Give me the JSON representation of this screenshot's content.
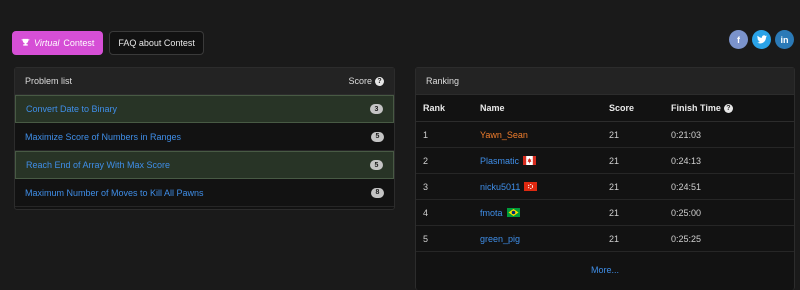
{
  "topbar": {
    "virtual_label_italic": "Virtual",
    "virtual_label_rest": "Contest",
    "faq_label": "FAQ about Contest",
    "social": [
      {
        "icon": "facebook-icon",
        "glyph": "f",
        "color": "#7b93cc"
      },
      {
        "icon": "twitter-icon",
        "glyph": "t",
        "color": "#2aa3e8"
      },
      {
        "icon": "linkedin-icon",
        "glyph": "in",
        "color": "#2b7ab7"
      }
    ]
  },
  "problems": {
    "title": "Problem list",
    "score_header": "Score",
    "items": [
      {
        "title": "Convert Date to Binary",
        "score": "3",
        "solved": true
      },
      {
        "title": "Maximize Score of Numbers in Ranges",
        "score": "5",
        "solved": false
      },
      {
        "title": "Reach End of Array With Max Score",
        "score": "5",
        "solved": true
      },
      {
        "title": "Maximum Number of Moves to Kill All Pawns",
        "score": "8",
        "solved": false
      }
    ]
  },
  "ranking": {
    "title": "Ranking",
    "columns": {
      "rank": "Rank",
      "name": "Name",
      "score": "Score",
      "time": "Finish Time"
    },
    "rows": [
      {
        "rank": "1",
        "name": "Yawn_Sean",
        "name_color": "#f07d2c",
        "flag": "",
        "score": "21",
        "time": "0:21:03"
      },
      {
        "rank": "2",
        "name": "Plasmatic",
        "name_color": "#3f8ee8",
        "flag": "canada-flag-icon",
        "score": "21",
        "time": "0:24:13"
      },
      {
        "rank": "3",
        "name": "nicku5011",
        "name_color": "#3f8ee8",
        "flag": "hong-kong-flag-icon",
        "score": "21",
        "time": "0:24:51"
      },
      {
        "rank": "4",
        "name": "fmota",
        "name_color": "#3f8ee8",
        "flag": "brazil-flag-icon",
        "score": "21",
        "time": "0:25:00"
      },
      {
        "rank": "5",
        "name": "green_pig",
        "name_color": "#3f8ee8",
        "flag": "",
        "score": "21",
        "time": "0:25:25"
      }
    ],
    "more_label": "More..."
  },
  "colors": {
    "accent_virtual": "#d64fd6",
    "link": "#3f8ee8",
    "solved_row": "#283426"
  }
}
